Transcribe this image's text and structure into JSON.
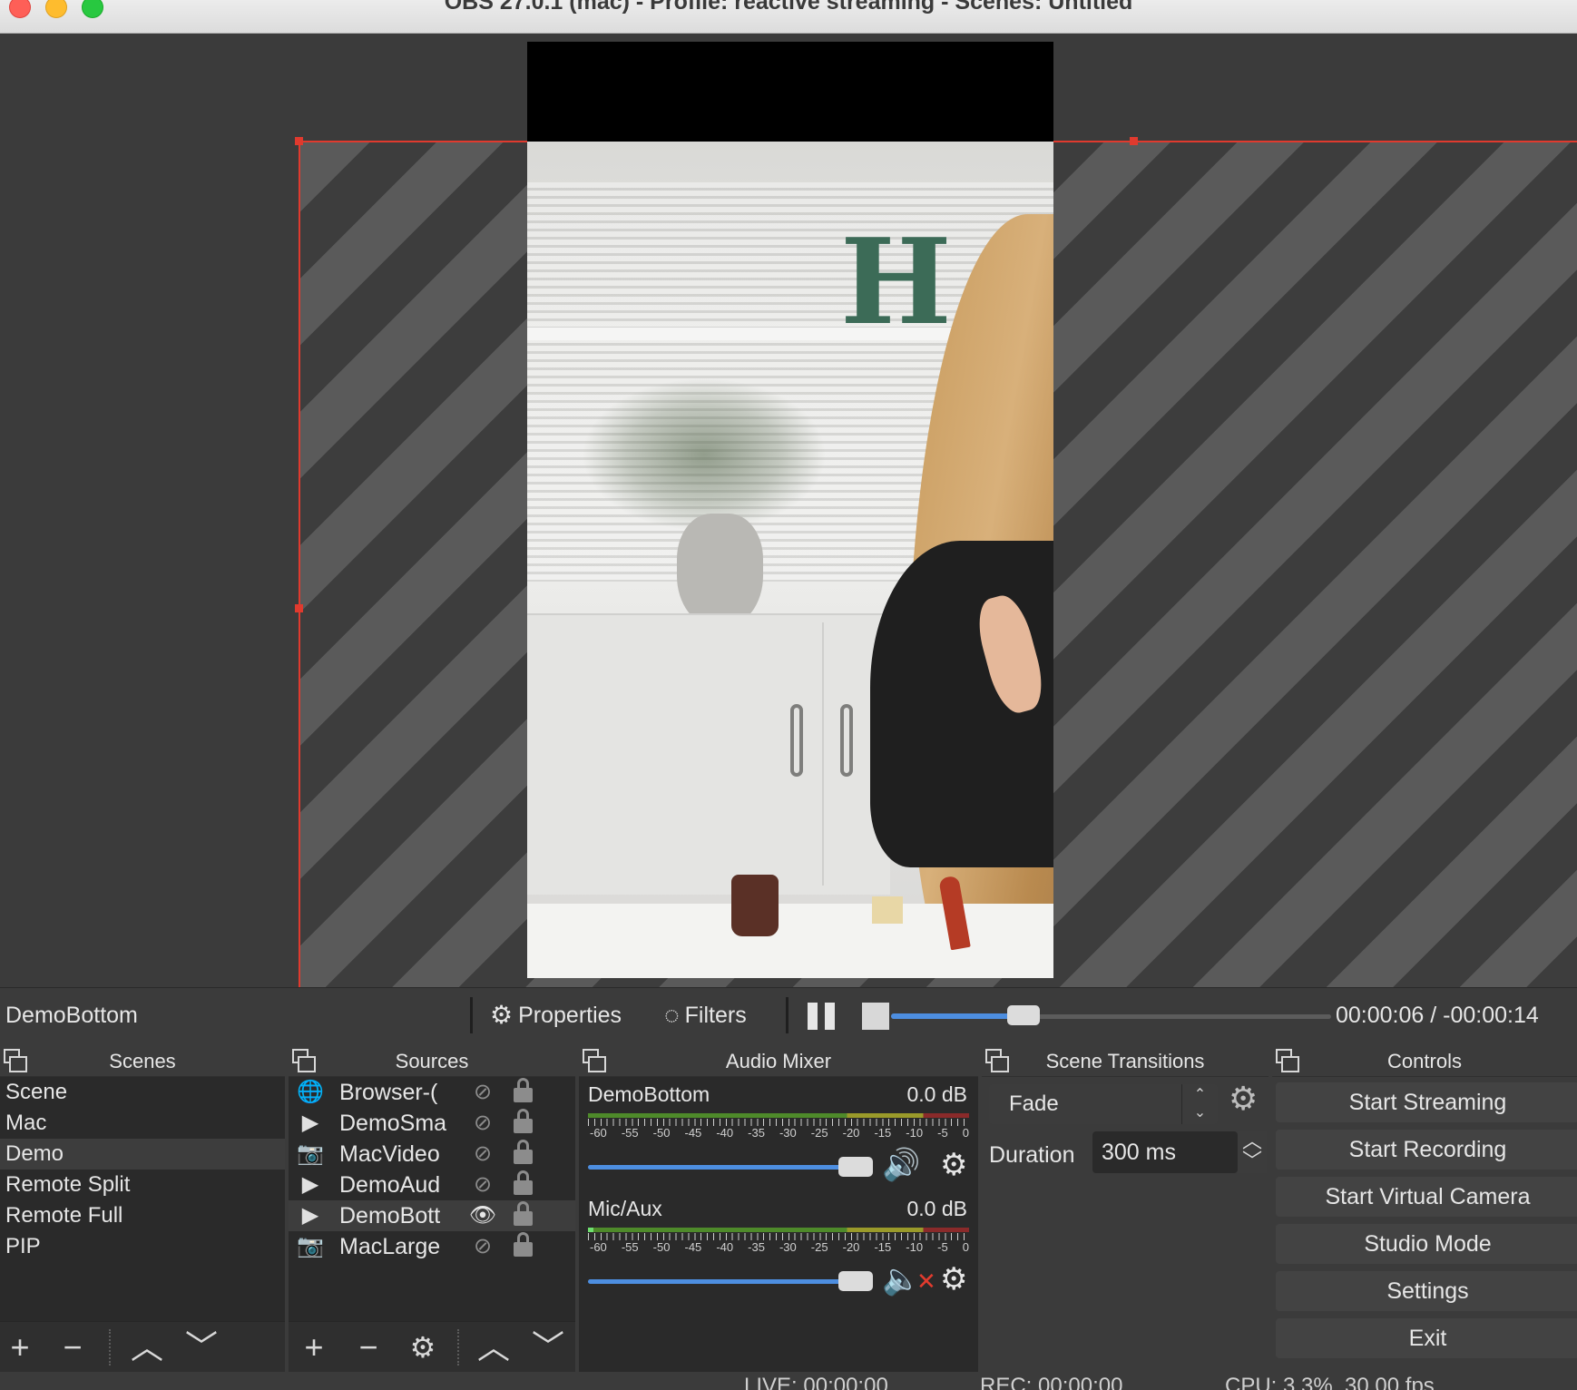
{
  "window": {
    "title": "OBS 27.0.1 (mac) - Profile: reactive streaming - Scenes: Untitled"
  },
  "preview": {
    "video_letter": "H"
  },
  "controls_bar": {
    "source_name": "DemoBottom",
    "properties_label": "Properties",
    "filters_label": "Filters",
    "seek_progress": 0.3,
    "time": "00:00:06 / -00:00:14"
  },
  "scenes": {
    "title": "Scenes",
    "items": [
      {
        "label": "Scene",
        "selected": false
      },
      {
        "label": "Mac",
        "selected": false
      },
      {
        "label": "Demo",
        "selected": true
      },
      {
        "label": "Remote Split",
        "selected": false
      },
      {
        "label": "Remote Full",
        "selected": false
      },
      {
        "label": "PIP",
        "selected": false
      }
    ]
  },
  "sources": {
    "title": "Sources",
    "items": [
      {
        "label": "Browser-(",
        "type_icon": "globe-icon",
        "visible": false,
        "selected": false
      },
      {
        "label": "DemoSma",
        "type_icon": "play-icon",
        "visible": false,
        "selected": false
      },
      {
        "label": "MacVideo",
        "type_icon": "camera-icon",
        "visible": false,
        "selected": false
      },
      {
        "label": "DemoAud",
        "type_icon": "play-icon",
        "visible": false,
        "selected": false
      },
      {
        "label": "DemoBott",
        "type_icon": "play-icon",
        "visible": true,
        "selected": true
      },
      {
        "label": "MacLarge",
        "type_icon": "camera-icon",
        "visible": false,
        "selected": false
      }
    ]
  },
  "mixer": {
    "title": "Audio Mixer",
    "tick_labels": [
      "-60",
      "-55",
      "-50",
      "-45",
      "-40",
      "-35",
      "-30",
      "-25",
      "-20",
      "-15",
      "-10",
      "-5",
      "0"
    ],
    "channels": [
      {
        "name": "DemoBottom",
        "db": "0.0 dB",
        "muted": false,
        "volume": 1.0
      },
      {
        "name": "Mic/Aux",
        "db": "0.0 dB",
        "muted": true,
        "volume": 1.0
      }
    ]
  },
  "transitions": {
    "title": "Scene Transitions",
    "selected": "Fade",
    "duration_label": "Duration",
    "duration_value": "300 ms"
  },
  "controls": {
    "title": "Controls",
    "buttons": [
      "Start Streaming",
      "Start Recording",
      "Start Virtual Camera",
      "Studio Mode",
      "Settings",
      "Exit"
    ]
  },
  "status": {
    "live": "LIVE: 00:00:00",
    "rec": "REC: 00:00:00",
    "cpu": "CPU: 3.3%, 30.00 fps"
  },
  "colors": {
    "selection_outline": "#e03a2e",
    "slider_blue": "#4d8ee0",
    "mute_red": "#e23b2e"
  }
}
